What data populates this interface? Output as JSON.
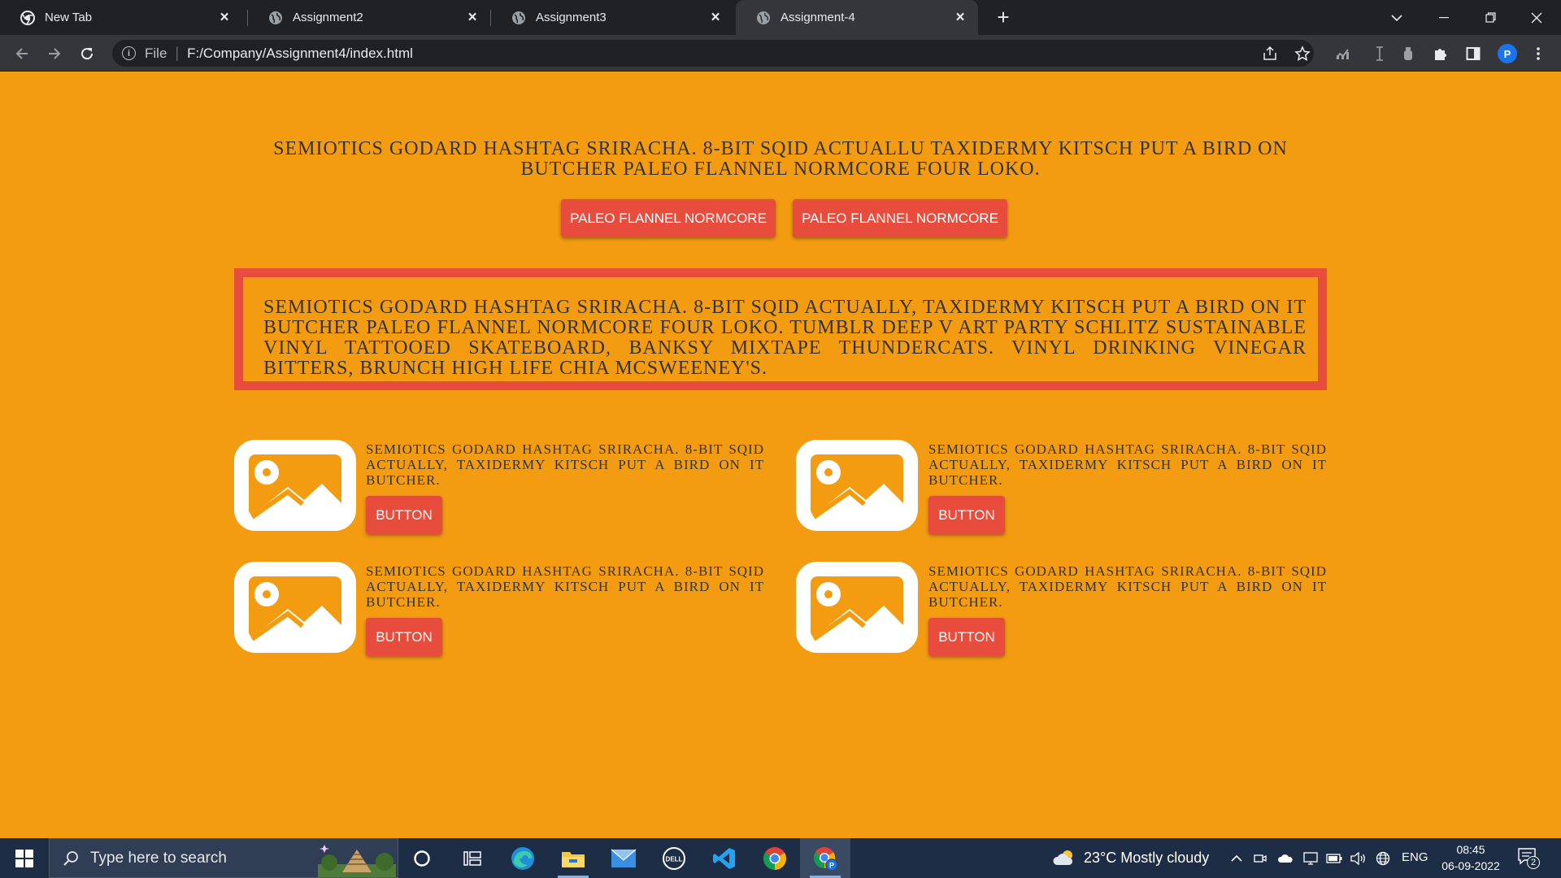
{
  "browser": {
    "tabs": [
      {
        "label": "New Tab",
        "icon": "chrome-icon",
        "active": false
      },
      {
        "label": "Assignment2",
        "icon": "globe-icon",
        "active": false
      },
      {
        "label": "Assignment3",
        "icon": "globe-icon",
        "active": false
      },
      {
        "label": "Assignment-4",
        "icon": "globe-icon",
        "active": true
      }
    ],
    "address": {
      "scheme_label": "File",
      "url": "F:/Company/Assignment4/index.html"
    },
    "profile_initial": "P"
  },
  "page": {
    "background": "#f39c12",
    "accent": "#e74c3c",
    "hero_text": "SEMIOTICS GODARD HASHTAG SRIRACHA. 8-BIT SQID ACTUALLU TAXIDERMY KITSCH PUT A BIRD ON BUTCHER PALEO FLANNEL NORMCORE FOUR LOKO.",
    "hero_buttons": [
      "PALEO FLANNEL NORMCORE",
      "PALEO FLANNEL NORMCORE"
    ],
    "bordered_text": "SEMIOTICS GODARD HASHTAG SRIRACHA. 8-BIT SQID ACTUALLY, TAXIDERMY KITSCH PUT A BIRD ON IT BUTCHER PALEO FLANNEL NORMCORE FOUR LOKO. TUMBLR DEEP V ART PARTY SCHLITZ SUSTAINABLE VINYL TATTOOED SKATEBOARD, BANKSY MIXTAPE THUNDERCATS. VINYL DRINKING VINEGAR BITTERS, BRUNCH HIGH LIFE CHIA MCSWEENEY'S.",
    "cards": [
      {
        "text": "SEMIOTICS GODARD HASHTAG SRIRACHA. 8-BIT SQID ACTUALLY, TAXIDERMY KITSCH PUT A BIRD ON IT BUTCHER.",
        "button": "BUTTON"
      },
      {
        "text": "SEMIOTICS GODARD HASHTAG SRIRACHA. 8-BIT SQID ACTUALLY, TAXIDERMY KITSCH PUT A BIRD ON IT BUTCHER.",
        "button": "BUTTON"
      },
      {
        "text": "SEMIOTICS GODARD HASHTAG SRIRACHA. 8-BIT SQID ACTUALLY, TAXIDERMY KITSCH PUT A BIRD ON IT BUTCHER.",
        "button": "BUTTON"
      },
      {
        "text": "SEMIOTICS GODARD HASHTAG SRIRACHA. 8-BIT SQID ACTUALLY, TAXIDERMY KITSCH PUT A BIRD ON IT BUTCHER.",
        "button": "BUTTON"
      }
    ]
  },
  "taskbar": {
    "search_placeholder": "Type here to search",
    "weather": "23°C  Mostly cloudy",
    "language": "ENG",
    "time": "08:45",
    "date": "06-09-2022",
    "notification_count": "2"
  }
}
